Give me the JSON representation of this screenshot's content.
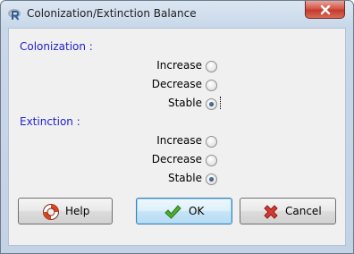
{
  "window": {
    "title": "Colonization/Extinction Balance"
  },
  "colonization": {
    "label": "Colonization :",
    "options": [
      {
        "label": "Increase",
        "checked": false
      },
      {
        "label": "Decrease",
        "checked": false
      },
      {
        "label": "Stable",
        "checked": true
      }
    ]
  },
  "extinction": {
    "label": "Extinction :",
    "options": [
      {
        "label": "Increase",
        "checked": false
      },
      {
        "label": "Decrease",
        "checked": false
      },
      {
        "label": "Stable",
        "checked": true
      }
    ]
  },
  "buttons": {
    "help": "Help",
    "ok": "OK",
    "cancel": "Cancel"
  },
  "icons": {
    "app": "r-logo-icon",
    "close": "close-icon",
    "help": "lifebuoy-icon",
    "ok": "green-checkmark-icon",
    "cancel": "red-x-icon"
  },
  "colors": {
    "section_label": "#1f1fd0",
    "close_button": "#c43a2b",
    "ok_check": "#3f9a2b",
    "cancel_x": "#c62828"
  }
}
